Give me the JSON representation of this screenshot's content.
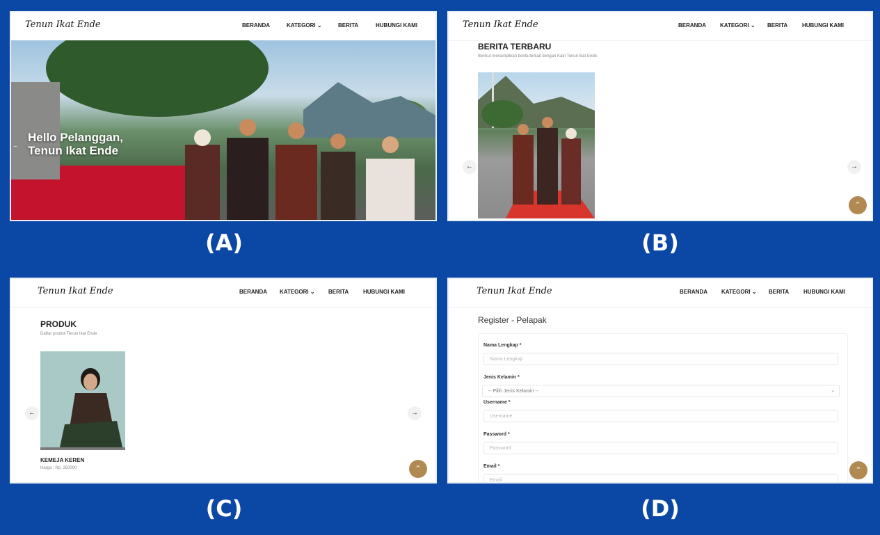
{
  "site": {
    "logo": "Tenun Ikat Ende",
    "nav": [
      "BERANDA",
      "KATEGORI ⌄",
      "BERITA",
      "HUBUNGI KAMI"
    ]
  },
  "panelA": {
    "hero_line1": "Hello Pelanggan,",
    "hero_line2": "Tenun Ikat Ende",
    "caption": "(A)"
  },
  "panelB": {
    "title": "BERITA TERBARU",
    "subtitle": "Berikut menampilkan berita terkait dengan Kain Tenun Ikat Ende.",
    "caption": "(B)"
  },
  "panelC": {
    "title": "PRODUK",
    "subtitle": "Daftar produk Tenun Ikat Ende",
    "product_name": "KEMEJA KEREN",
    "product_price": "Harga : Rp. 250000",
    "caption": "(C)"
  },
  "panelD": {
    "title": "Register - Pelapak",
    "fields": [
      {
        "label": "Nama Lengkap *",
        "placeholder": "Nama Lengkap"
      },
      {
        "label": "Jenis Kelamin *",
        "placeholder": "-- Pilih Jenis Kelamin --"
      },
      {
        "label": "Username *",
        "placeholder": "Username"
      },
      {
        "label": "Password *",
        "placeholder": "Password"
      },
      {
        "label": "Email *",
        "placeholder": "Email"
      }
    ],
    "caption": "(D)"
  },
  "icons": {
    "prev": "←",
    "next": "→",
    "scroll_top": "⌃",
    "chevron": "⌄"
  },
  "colors": {
    "background": "#0b47a4",
    "scroll_top_button": "#b08a52"
  }
}
